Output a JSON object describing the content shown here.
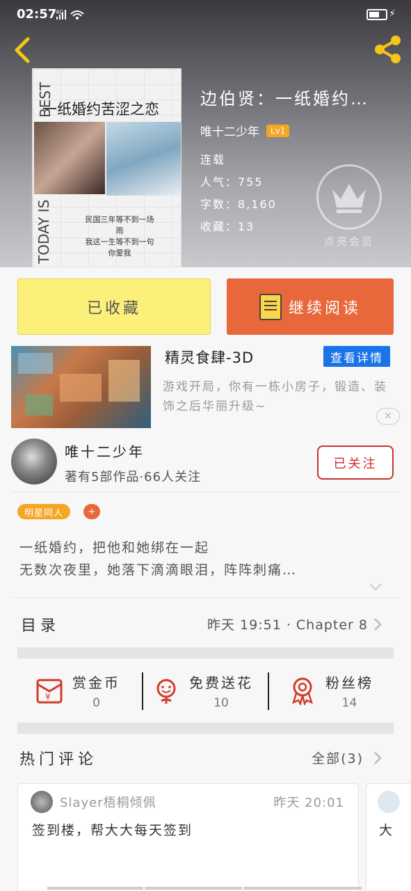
{
  "status": {
    "time": "02:57",
    "network": "4G"
  },
  "book": {
    "title": "边伯贤：一纸婚约…",
    "author": "唯十二少年",
    "level": "Lv1",
    "state": "连载",
    "popularity": "人气：755",
    "words": "字数：8,160",
    "collections": "收藏：13",
    "vip_label": "点亮会员"
  },
  "cover": {
    "title": "一纸婚约苦涩之恋",
    "side_top": "BEST",
    "side_bottom": "TODAY IS",
    "lines": [
      "民国三年等不到一场",
      "雨",
      "我这一生等不到一句",
      "你爱我"
    ]
  },
  "actions": {
    "collected": "已收藏",
    "continue_read": "继续阅读"
  },
  "ad": {
    "title": "精灵食肆-3D",
    "detail_button": "查看详情",
    "desc": "游戏开局，你有一栋小房子，锻造、装饰之后华丽升级~"
  },
  "author_card": {
    "name": "唯十二少年",
    "stats": "著有5部作品·66人关注",
    "follow_button": "已关注"
  },
  "tags": {
    "items": [
      "明星同人"
    ],
    "add": "+"
  },
  "summary": [
    "一纸婚约，把他和她绑在一起",
    "无数次夜里，她落下滴滴眼泪，阵阵刺痛…"
  ],
  "toc": {
    "label": "目录",
    "latest": "昨天 19:51 · Chapter 8"
  },
  "stats": [
    {
      "label": "赏金币",
      "value": "0"
    },
    {
      "label": "免费送花",
      "value": "10"
    },
    {
      "label": "粉丝榜",
      "value": "14"
    }
  ],
  "comments": {
    "header": "热门评论",
    "all_label": "全部(3)",
    "items": [
      {
        "user": "Slayer梧桐倾佩",
        "time": "昨天 20:01",
        "text": "签到楼，帮大大每天签到"
      },
      {
        "text": "大"
      }
    ]
  },
  "colors": {
    "collect_bg": "#fbf07a",
    "read_bg": "#e8683b",
    "follow": "#c9302c",
    "detail_bg": "#1a73e8",
    "tag": "#f5a623"
  }
}
